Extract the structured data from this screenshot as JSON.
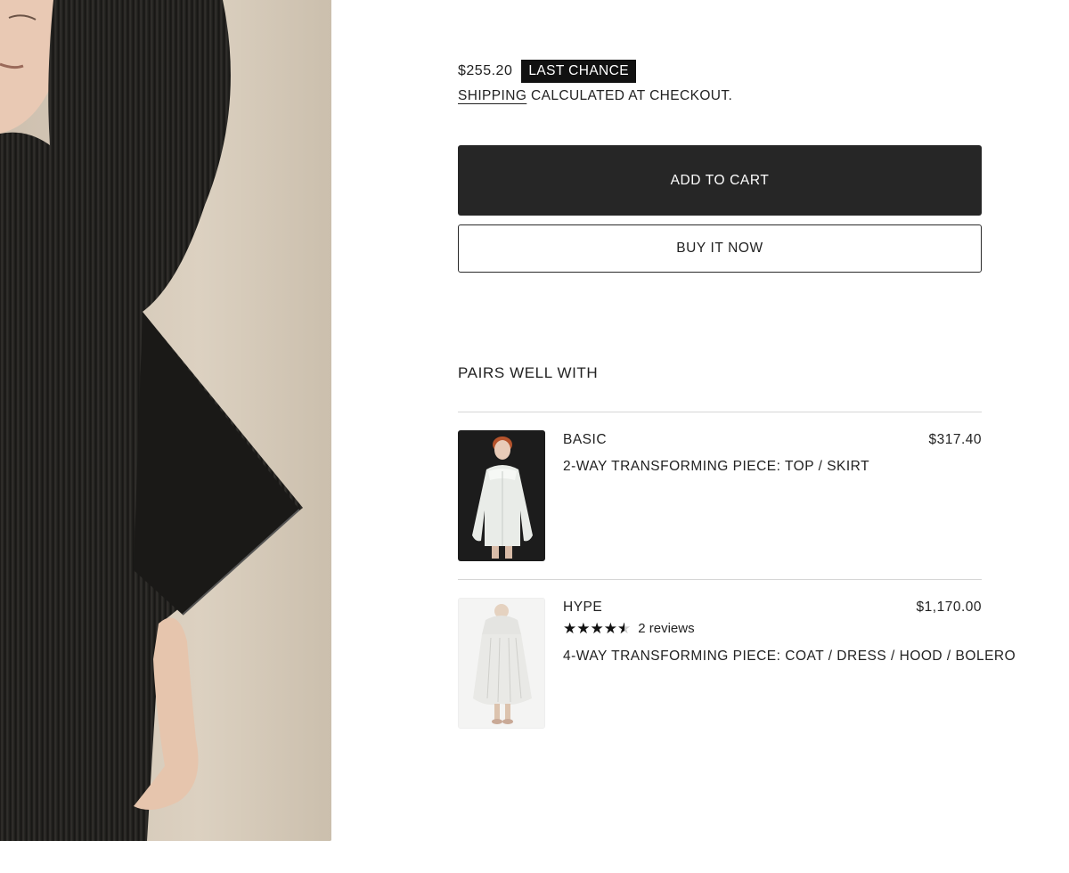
{
  "product": {
    "price": "$255.20",
    "badge": "LAST CHANCE",
    "shipping_link": "SHIPPING",
    "shipping_text": "CALCULATED AT CHECKOUT."
  },
  "actions": {
    "add_to_cart": "ADD TO CART",
    "buy_now": "BUY IT NOW"
  },
  "pairs": {
    "title": "PAIRS WELL WITH",
    "items": [
      {
        "name": "BASIC",
        "price": "$317.40",
        "description": "2-WAY TRANSFORMING PIECE: TOP / SKIRT"
      },
      {
        "name": "HYPE",
        "price": "$1,170.00",
        "rating": 4.5,
        "reviews_label": "2 reviews",
        "description": "4-WAY TRANSFORMING PIECE: COAT / DRESS / HOOD / BOLERO"
      }
    ]
  },
  "colors": {
    "primary_button": "#262626",
    "badge_bg": "#111111",
    "text": "#222222",
    "divider": "#d6d6d6"
  }
}
